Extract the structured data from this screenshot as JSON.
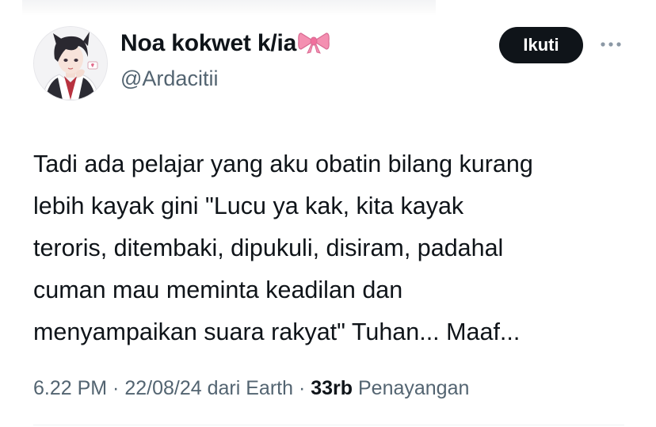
{
  "author": {
    "display_name": "Noa kokwet k/ia",
    "emoji": "ribbon-bow",
    "handle": "@Ardacitii",
    "avatar_icon": "anime-boy-avatar"
  },
  "actions": {
    "follow_label": "Ikuti",
    "more_icon": "more-horizontal-icon"
  },
  "tweet": {
    "lines": [
      "Tadi ada pelajar yang aku obatin bilang kurang",
      "lebih kayak gini \"Lucu ya kak, kita kayak",
      "teroris, ditembaki, dipukuli, disiram, padahal",
      "cuman mau meminta keadilan dan",
      "menyampaikan suara rakyat\" Tuhan... Maaf..."
    ]
  },
  "meta": {
    "time": "6.22 PM",
    "sep1": " · ",
    "date": "22/08/24",
    "source_prefix": " dari ",
    "source": "Earth",
    "sep2": " · ",
    "views_count": "33rb",
    "views_label": " Penayangan"
  },
  "colors": {
    "text_primary": "#0f1419",
    "text_secondary": "#536471",
    "button_bg": "#0f1419",
    "bow_pink": "#f48fb1"
  }
}
